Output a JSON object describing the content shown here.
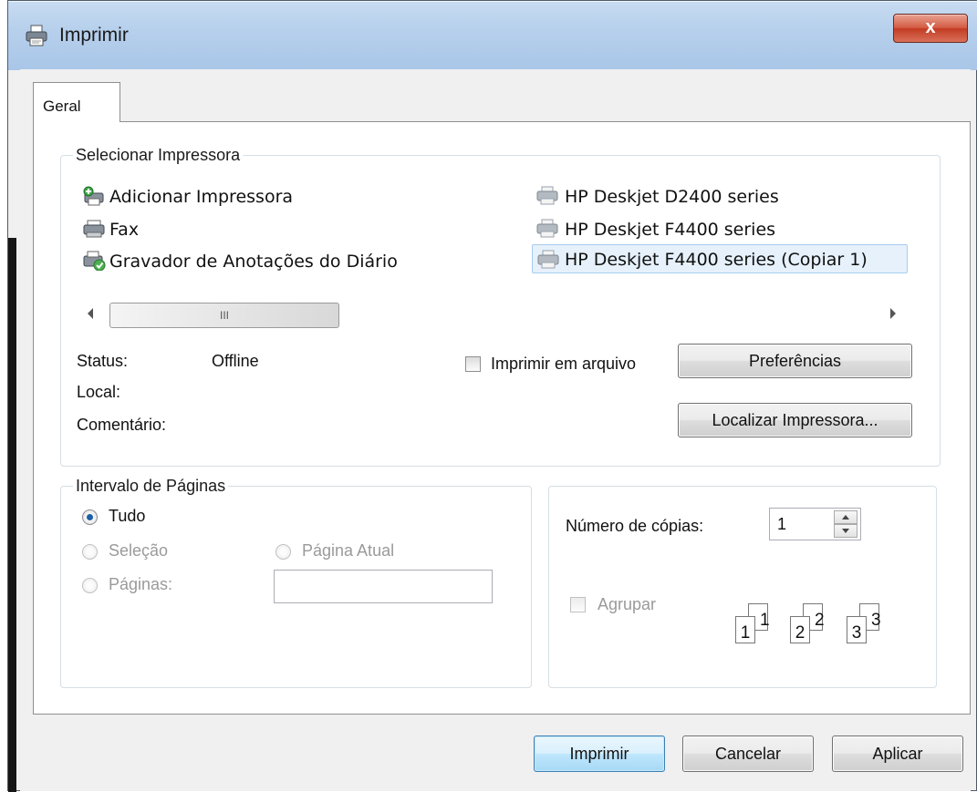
{
  "window": {
    "title": "Imprimir",
    "close_label": "x"
  },
  "tabs": [
    {
      "label": "Geral"
    }
  ],
  "printer_group": {
    "legend": "Selecionar Impressora",
    "printers_left": [
      {
        "name": "Adicionar Impressora",
        "icon": "add-printer-icon"
      },
      {
        "name": "Fax",
        "icon": "fax-icon"
      },
      {
        "name": "Gravador de Anotações do Diário",
        "icon": "journal-writer-icon"
      }
    ],
    "printers_right": [
      {
        "name": "HP Deskjet D2400 series",
        "icon": "printer-icon"
      },
      {
        "name": "HP Deskjet F4400 series",
        "icon": "printer-icon"
      },
      {
        "name": "HP Deskjet F4400 series (Copiar 1)",
        "icon": "printer-icon",
        "selected": true
      }
    ],
    "scroll_thumb_grip": "III",
    "status_label": "Status:",
    "status_value": "Offline",
    "local_label": "Local:",
    "comment_label": "Comentário:",
    "print_to_file_label": "Imprimir em arquivo",
    "preferences_button": "Preferências",
    "find_printer_button": "Localizar Impressora..."
  },
  "page_range": {
    "legend": "Intervalo de Páginas",
    "all_label": "Tudo",
    "selection_label": "Seleção",
    "current_page_label": "Página Atual",
    "pages_label": "Páginas:",
    "pages_value": ""
  },
  "copies": {
    "label": "Número de cópias:",
    "value": "1",
    "collate_label": "Agrupar",
    "collate_icons": [
      "1",
      "1",
      "2",
      "2",
      "3",
      "3"
    ]
  },
  "footer": {
    "print_button": "Imprimir",
    "cancel_button": "Cancelar",
    "apply_button": "Aplicar"
  },
  "colors": {
    "titlebar": "#b7d0ec",
    "close": "#c23b22",
    "selection": "#dceefc",
    "radio_dot": "#1b5fa8"
  }
}
